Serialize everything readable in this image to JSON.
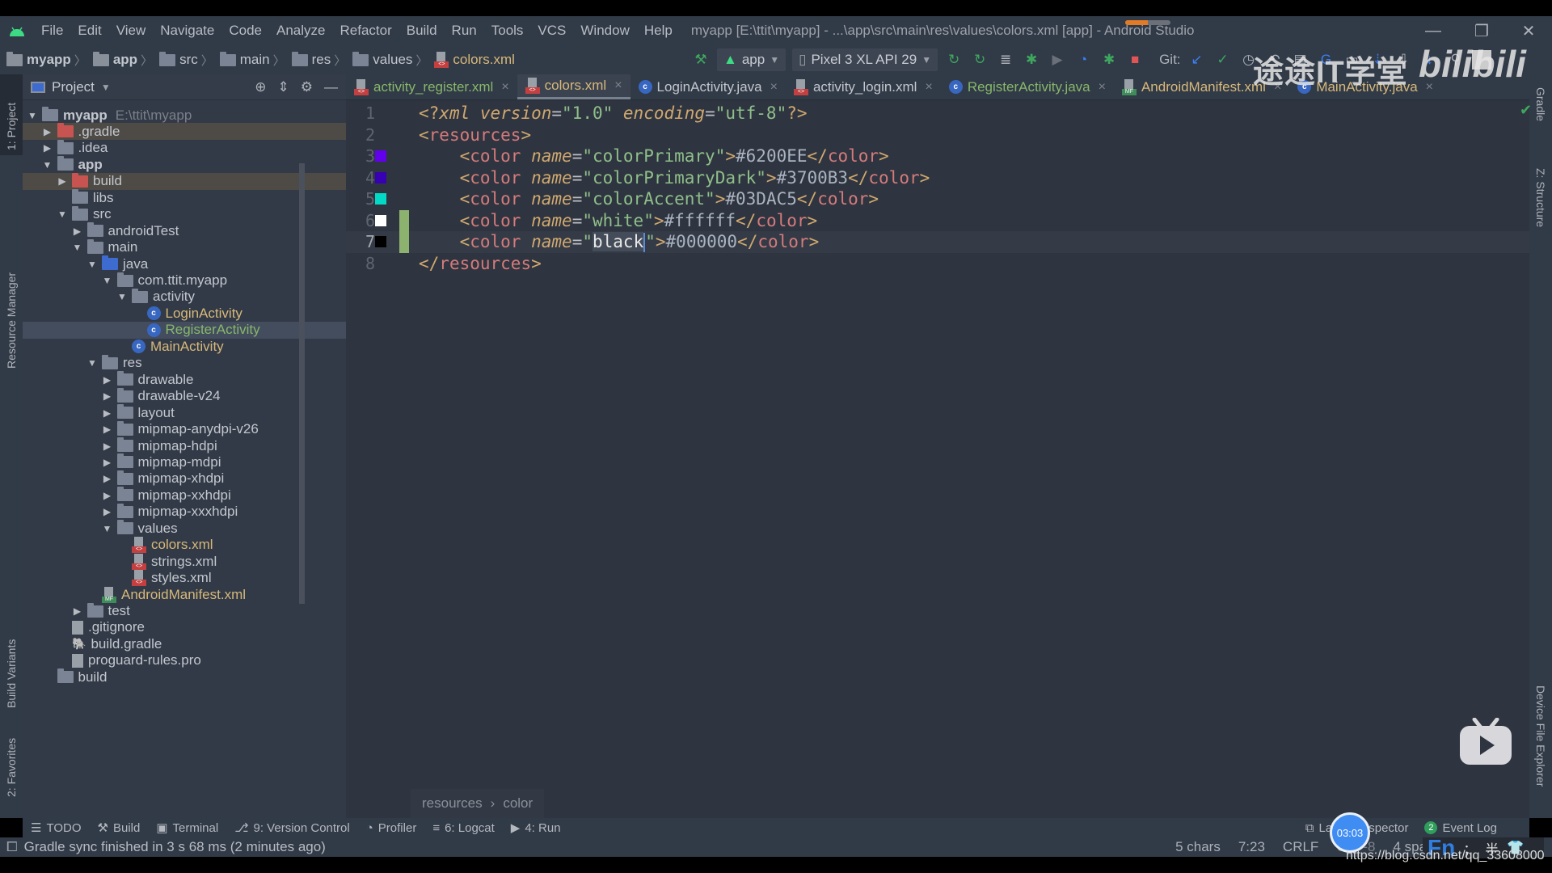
{
  "window": {
    "title": "myapp [E:\\ttit\\myapp] - ...\\app\\src\\main\\res\\values\\colors.xml [app] - Android Studio",
    "controls": {
      "minimize": "—",
      "restore": "❐",
      "close": "✕"
    },
    "progress_indicator_fraction": 0.5
  },
  "menu": [
    "File",
    "Edit",
    "View",
    "Navigate",
    "Code",
    "Analyze",
    "Refactor",
    "Build",
    "Run",
    "Tools",
    "VCS",
    "Window",
    "Help"
  ],
  "breadcrumb": [
    "myapp",
    "app",
    "src",
    "main",
    "res",
    "values",
    "colors.xml"
  ],
  "toolbar": {
    "run_config": "app",
    "device": "Pixel 3 XL API 29",
    "git_label": "Git:"
  },
  "left_strip": {
    "project": "1: Project",
    "resource_manager": "Resource Manager",
    "build_variants": "Build Variants",
    "favorites": "2: Favorites"
  },
  "right_strip": {
    "gradle": "Gradle",
    "structure": "Z: Structure",
    "device_file_explorer": "Device File Explorer"
  },
  "project_panel": {
    "title": "Project",
    "tree": [
      {
        "label": "myapp",
        "extra": "E:\\ttit\\myapp",
        "depth": 0,
        "arrow": "down",
        "icon": "module-folder",
        "bold": true
      },
      {
        "label": ".gradle",
        "depth": 1,
        "arrow": "right",
        "icon": "folder-red",
        "excluded": true
      },
      {
        "label": ".idea",
        "depth": 1,
        "arrow": "right",
        "icon": "folder"
      },
      {
        "label": "app",
        "depth": 1,
        "arrow": "down",
        "icon": "module-folder",
        "bold": true
      },
      {
        "label": "build",
        "depth": 2,
        "arrow": "right",
        "icon": "folder-red",
        "excluded": true
      },
      {
        "label": "libs",
        "depth": 2,
        "arrow": "",
        "icon": "folder"
      },
      {
        "label": "src",
        "depth": 2,
        "arrow": "down",
        "icon": "folder"
      },
      {
        "label": "androidTest",
        "depth": 3,
        "arrow": "right",
        "icon": "folder"
      },
      {
        "label": "main",
        "depth": 3,
        "arrow": "down",
        "icon": "folder"
      },
      {
        "label": "java",
        "depth": 4,
        "arrow": "down",
        "icon": "folder-blue"
      },
      {
        "label": "com.ttit.myapp",
        "depth": 5,
        "arrow": "down",
        "icon": "package"
      },
      {
        "label": "activity",
        "depth": 6,
        "arrow": "down",
        "icon": "package"
      },
      {
        "label": "LoginActivity",
        "depth": 7,
        "arrow": "",
        "icon": "class",
        "color": "yellow"
      },
      {
        "label": "RegisterActivity",
        "depth": 7,
        "arrow": "",
        "icon": "class",
        "color": "green",
        "selected": true
      },
      {
        "label": "MainActivity",
        "depth": 6,
        "arrow": "",
        "icon": "class",
        "color": "yellow"
      },
      {
        "label": "res",
        "depth": 4,
        "arrow": "down",
        "icon": "res-folder"
      },
      {
        "label": "drawable",
        "depth": 5,
        "arrow": "right",
        "icon": "folder"
      },
      {
        "label": "drawable-v24",
        "depth": 5,
        "arrow": "right",
        "icon": "folder"
      },
      {
        "label": "layout",
        "depth": 5,
        "arrow": "right",
        "icon": "folder"
      },
      {
        "label": "mipmap-anydpi-v26",
        "depth": 5,
        "arrow": "right",
        "icon": "folder"
      },
      {
        "label": "mipmap-hdpi",
        "depth": 5,
        "arrow": "right",
        "icon": "folder"
      },
      {
        "label": "mipmap-mdpi",
        "depth": 5,
        "arrow": "right",
        "icon": "folder"
      },
      {
        "label": "mipmap-xhdpi",
        "depth": 5,
        "arrow": "right",
        "icon": "folder"
      },
      {
        "label": "mipmap-xxhdpi",
        "depth": 5,
        "arrow": "right",
        "icon": "folder"
      },
      {
        "label": "mipmap-xxxhdpi",
        "depth": 5,
        "arrow": "right",
        "icon": "folder"
      },
      {
        "label": "values",
        "depth": 5,
        "arrow": "down",
        "icon": "folder"
      },
      {
        "label": "colors.xml",
        "depth": 6,
        "arrow": "",
        "icon": "xml",
        "color": "yellow"
      },
      {
        "label": "strings.xml",
        "depth": 6,
        "arrow": "",
        "icon": "xml"
      },
      {
        "label": "styles.xml",
        "depth": 6,
        "arrow": "",
        "icon": "xml"
      },
      {
        "label": "AndroidManifest.xml",
        "depth": 4,
        "arrow": "",
        "icon": "manifest",
        "color": "yellow"
      },
      {
        "label": "test",
        "depth": 3,
        "arrow": "right",
        "icon": "folder"
      },
      {
        "label": ".gitignore",
        "depth": 2,
        "arrow": "",
        "icon": "file"
      },
      {
        "label": "build.gradle",
        "depth": 2,
        "arrow": "",
        "icon": "gradle"
      },
      {
        "label": "proguard-rules.pro",
        "depth": 2,
        "arrow": "",
        "icon": "file"
      },
      {
        "label": "build",
        "depth": 1,
        "arrow": "",
        "icon": "folder"
      }
    ]
  },
  "editor_tabs": [
    {
      "label": "activity_register.xml",
      "icon": "xml",
      "color": "green"
    },
    {
      "label": "colors.xml",
      "icon": "xml",
      "color": "yellow",
      "active": true
    },
    {
      "label": "LoginActivity.java",
      "icon": "class",
      "color": "default"
    },
    {
      "label": "activity_login.xml",
      "icon": "xml",
      "color": "default"
    },
    {
      "label": "RegisterActivity.java",
      "icon": "class",
      "color": "green"
    },
    {
      "label": "AndroidManifest.xml",
      "icon": "manifest",
      "color": "yellow"
    },
    {
      "label": "MainActivity.java",
      "icon": "class",
      "color": "yellow"
    }
  ],
  "code": {
    "xml_decl": {
      "version": "1.0",
      "encoding": "utf-8"
    },
    "root_tag": "resources",
    "colors": [
      {
        "line": 3,
        "name": "colorPrimary",
        "value": "#6200EE",
        "swatch": "#6200EE"
      },
      {
        "line": 4,
        "name": "colorPrimaryDark",
        "value": "#3700B3",
        "swatch": "#3700B3"
      },
      {
        "line": 5,
        "name": "colorAccent",
        "value": "#03DAC5",
        "swatch": "#03DAC5"
      },
      {
        "line": 6,
        "name": "white",
        "value": "#ffffff",
        "swatch": "#ffffff"
      },
      {
        "line": 7,
        "name": "black",
        "value": "#000000",
        "swatch": "#000000"
      }
    ],
    "line_numbers": [
      "1",
      "2",
      "3",
      "4",
      "5",
      "6",
      "7",
      "8"
    ],
    "current_line": 7,
    "changed_lines": [
      6,
      7
    ]
  },
  "editor_breadcrumb": [
    "resources",
    "color"
  ],
  "bottom_tools": [
    "TODO",
    "Build",
    "Terminal",
    "9: Version Control",
    "Profiler",
    "6: Logcat",
    "4: Run"
  ],
  "bottom_right_tools": {
    "layout_inspector": "Layout Inspector",
    "event_log": "Event Log",
    "event_count": "2"
  },
  "status": {
    "message": "Gradle sync finished in 3 s 68 ms (2 minutes ago)",
    "selection": "5 chars",
    "position": "7:23",
    "line_sep": "CRLF",
    "encoding": "UTF-8",
    "indent": "4 spaces",
    "vcs": "Git:"
  },
  "overlay": {
    "timer": "03:03",
    "watermark_text": "途途IT学堂",
    "watermark_brand": "bilibili",
    "url": "https://blog.csdn.net/qq_33608000",
    "ime": "Fn"
  }
}
